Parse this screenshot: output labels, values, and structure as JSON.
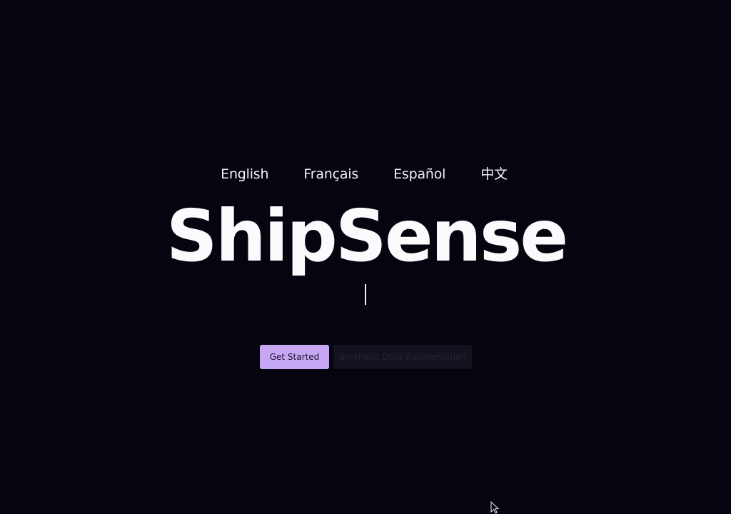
{
  "languages": [
    {
      "label": "English"
    },
    {
      "label": "Français"
    },
    {
      "label": "Español"
    },
    {
      "label": "中文"
    }
  ],
  "hero": {
    "title": "ShipSense"
  },
  "actions": {
    "primary_label": "Get Started",
    "secondary_label": "Synthetic Data Augmentation"
  },
  "colors": {
    "background": "#05040f",
    "accent": "#c7a7f3",
    "text": "#fbfbfd"
  },
  "icons": {
    "cursor": "mouse-pointer-icon"
  }
}
